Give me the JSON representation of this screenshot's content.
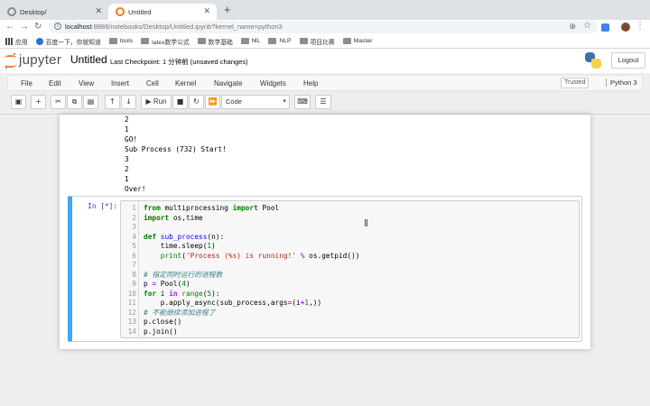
{
  "browser": {
    "tabs": [
      {
        "title": "Desktop/",
        "active": false
      },
      {
        "title": "Untitled",
        "active": true
      }
    ],
    "new_tab": "+",
    "url_host": "localhost",
    "url_rest": ":8888/notebooks/Desktop/Untitled.ipynb?kernel_name=python3",
    "bookmarks": [
      {
        "label": "应用",
        "icon": "apps-grid-icon"
      },
      {
        "label": "百度一下，你就知道",
        "icon": "site-icon"
      },
      {
        "label": "tools",
        "icon": "folder-icon"
      },
      {
        "label": "latex数学公式",
        "icon": "folder-icon"
      },
      {
        "label": "数学基础",
        "icon": "folder-icon"
      },
      {
        "label": "ML",
        "icon": "folder-icon"
      },
      {
        "label": "NLP",
        "icon": "folder-icon"
      },
      {
        "label": "项目比赛",
        "icon": "folder-icon"
      },
      {
        "label": "Master",
        "icon": "folder-icon"
      }
    ]
  },
  "header": {
    "brand": "jupyter",
    "notebook_name": "Untitled",
    "checkpoint": "Last Checkpoint: 1 分钟前   (unsaved changes)",
    "logout_label": "Logout"
  },
  "menubar": {
    "items": [
      "File",
      "Edit",
      "View",
      "Insert",
      "Cell",
      "Kernel",
      "Navigate",
      "Widgets",
      "Help"
    ],
    "trusted_label": "Trusted",
    "kernel_label": "Python 3"
  },
  "toolbar": {
    "save_glyph": "▣",
    "add_glyph": "+",
    "cut_glyph": "✂",
    "copy_glyph": "⧉",
    "paste_glyph": "▤",
    "up_glyph": "↑",
    "down_glyph": "↓",
    "run_glyph": "▶",
    "run_label": "Run",
    "stop_glyph": "■",
    "restart_glyph": "↻",
    "fastforward_glyph": "⏩",
    "cell_type": "Code",
    "keyboard_glyph": "⌨",
    "palette_glyph": "☰"
  },
  "output": {
    "text": "2\n1\nGO!\nSub Process (732) Start!\n3\n2\n1\nOver!"
  },
  "cell": {
    "prompt": "In [*]:",
    "line_numbers": [
      "1",
      "2",
      "3",
      "4",
      "5",
      "6",
      "7",
      "8",
      "9",
      "10",
      "11",
      "12",
      "13",
      "14"
    ]
  }
}
